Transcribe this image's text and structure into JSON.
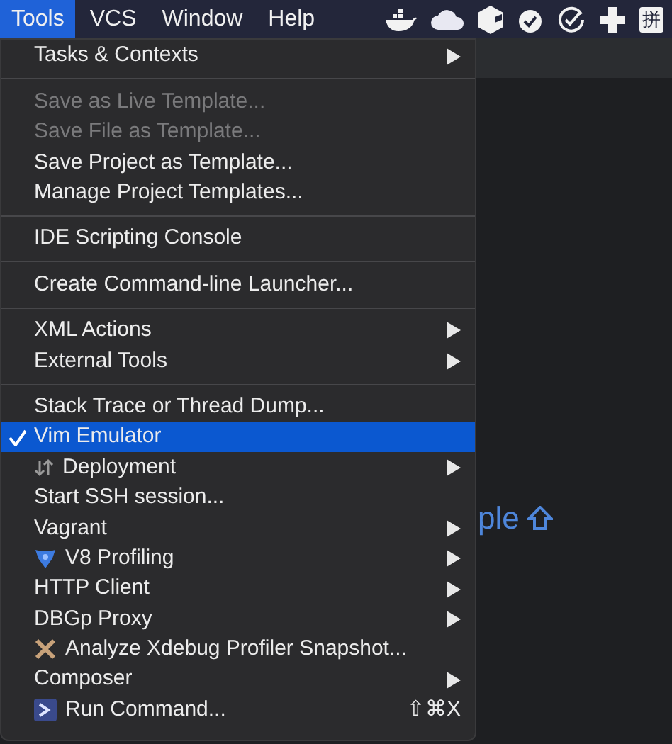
{
  "menu_bar": {
    "menus": [
      {
        "label": "Tools",
        "selected": true
      },
      {
        "label": "VCS",
        "selected": false
      },
      {
        "label": "Window",
        "selected": false
      },
      {
        "label": "Help",
        "selected": false
      }
    ],
    "status_icons": [
      {
        "kind": "whale"
      },
      {
        "kind": "cloud"
      },
      {
        "kind": "cube"
      },
      {
        "kind": "badge"
      },
      {
        "kind": "check"
      },
      {
        "kind": "plus"
      },
      {
        "kind": "text",
        "label": "拼"
      }
    ]
  },
  "background_hint": {
    "text": "ple"
  },
  "menu": [
    {
      "kind": "item",
      "label": "Tasks & Contexts",
      "submenu": true,
      "disabled": false,
      "checked": false,
      "selected": false
    },
    {
      "kind": "separator"
    },
    {
      "kind": "item",
      "label": "Save as Live Template...",
      "submenu": false,
      "disabled": true,
      "checked": false,
      "selected": false
    },
    {
      "kind": "item",
      "label": "Save File as Template...",
      "submenu": false,
      "disabled": true,
      "checked": false,
      "selected": false
    },
    {
      "kind": "item",
      "label": "Save Project as Template...",
      "submenu": false,
      "disabled": false,
      "checked": false,
      "selected": false
    },
    {
      "kind": "item",
      "label": "Manage Project Templates...",
      "submenu": false,
      "disabled": false,
      "checked": false,
      "selected": false
    },
    {
      "kind": "separator"
    },
    {
      "kind": "item",
      "label": "IDE Scripting Console",
      "submenu": false,
      "disabled": false,
      "checked": false,
      "selected": false
    },
    {
      "kind": "separator"
    },
    {
      "kind": "item",
      "label": "Create Command-line Launcher...",
      "submenu": false,
      "disabled": false,
      "checked": false,
      "selected": false
    },
    {
      "kind": "separator"
    },
    {
      "kind": "item",
      "label": "XML Actions",
      "submenu": true,
      "disabled": false,
      "checked": false,
      "selected": false
    },
    {
      "kind": "item",
      "label": "External Tools",
      "submenu": true,
      "disabled": false,
      "checked": false,
      "selected": false
    },
    {
      "kind": "separator"
    },
    {
      "kind": "item",
      "label": "Stack Trace or Thread Dump...",
      "submenu": false,
      "disabled": false,
      "checked": false,
      "selected": false
    },
    {
      "kind": "item",
      "label": "Vim Emulator",
      "submenu": false,
      "disabled": false,
      "checked": true,
      "selected": true
    },
    {
      "kind": "item",
      "label": "Deployment",
      "submenu": true,
      "disabled": false,
      "checked": false,
      "selected": false
    },
    {
      "kind": "item",
      "label": "Start SSH session...",
      "submenu": false,
      "disabled": false,
      "checked": false,
      "selected": false
    },
    {
      "kind": "item",
      "label": "Vagrant",
      "submenu": true,
      "disabled": false,
      "checked": false,
      "selected": false
    },
    {
      "kind": "item",
      "label": "V8 Profiling",
      "submenu": true,
      "disabled": false,
      "checked": false,
      "selected": false
    },
    {
      "kind": "item",
      "label": "HTTP Client",
      "submenu": true,
      "disabled": false,
      "checked": false,
      "selected": false
    },
    {
      "kind": "item",
      "label": "DBGp Proxy",
      "submenu": true,
      "disabled": false,
      "checked": false,
      "selected": false
    },
    {
      "kind": "item",
      "label": "Analyze Xdebug Profiler Snapshot...",
      "submenu": false,
      "disabled": false,
      "checked": false,
      "selected": false
    },
    {
      "kind": "item",
      "label": "Composer",
      "submenu": true,
      "disabled": false,
      "checked": false,
      "selected": false
    },
    {
      "kind": "item",
      "label": "Run Command...",
      "shortcut": "⇧⌘X",
      "submenu": false,
      "disabled": false,
      "checked": false,
      "selected": false
    }
  ]
}
